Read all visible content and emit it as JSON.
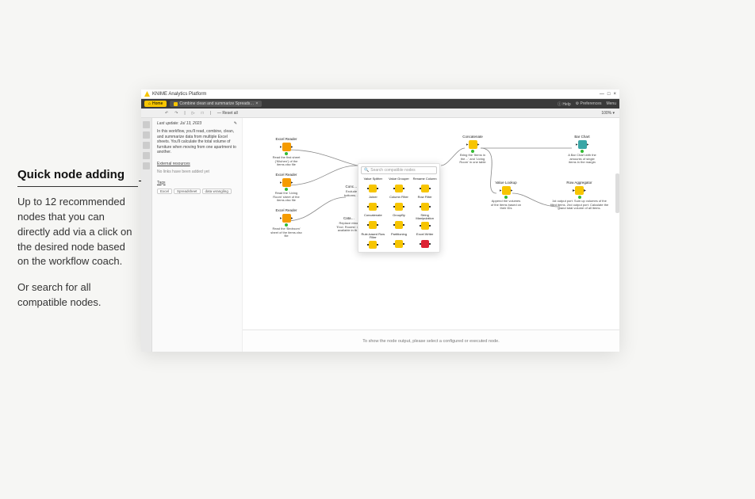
{
  "annotation": {
    "title": "Quick node adding",
    "p1": "Up to 12 recommended nodes that you can directly add via a click on the desired node based on the workflow coach.",
    "p2": "Or search for all compatible nodes."
  },
  "window": {
    "title": "KNIME Analytics Platform",
    "wmin": "—",
    "wmax": "□",
    "wclose": "×"
  },
  "topbar": {
    "home": "Home",
    "tab": "Combine clean and summarize Spreads…",
    "tab_close": "×",
    "help": "Help",
    "prefs": "Preferences",
    "menu": "Menu"
  },
  "toolbar": {
    "reset": "Reset all",
    "zoom": "100% ▾"
  },
  "side": {
    "date": "Last update: Jul 13, 2023",
    "desc": "In this workflow, you'll read, combine, clean, and summarize data from multiple Excel sheets. You'll calculate the total volume of furniture when moving from one apartment to another.",
    "ext": "External resources",
    "ext_note": "No links have been added yet",
    "tags_label": "Tags",
    "tags": [
      "Excel",
      "Spreadsheet",
      "data wrangling"
    ]
  },
  "wf": {
    "n1": {
      "label": "Excel Reader",
      "desc": "Read the first sheet ('Kitchen') of the items.xlsx file"
    },
    "n2": {
      "label": "Excel Reader",
      "desc": "Read the 'Living Room' sheet of the items.xlsx file"
    },
    "n3": {
      "label": "Excel Reader",
      "desc": "Read the 'Bedroom' sheet of the items.xlsx file"
    },
    "n4": {
      "label": "Conc…",
      "desc": "Exclude bottoms…"
    },
    "n5": {
      "label": "Cata…",
      "desc": "Replace miss. 'Excl. Rooms': us. available in th…"
    },
    "n6": {
      "label": "Concatenate",
      "desc": "Bring the 'Items in the…' and 'Living Room' in one table"
    },
    "n7": {
      "label": "Value Lookup",
      "desc": "Append the volumes of the items based on their IDs"
    },
    "n8": {
      "label": "Bar Chart",
      "desc": "A Bar Chart with the amounts of single items in the margin"
    },
    "n9": {
      "label": "Row Aggregator",
      "desc": "1st output port: Sum up volumes of the filled items. 2nd output port: Calculate the grand total volume of all items."
    }
  },
  "popup": {
    "search_ph": "Search compatible nodes",
    "items": [
      {
        "label": "Value Splitter",
        "cls": "yellow",
        "desc": ""
      },
      {
        "label": "Value Grouper",
        "cls": "yellow",
        "desc": ""
      },
      {
        "label": "Rename Column",
        "cls": "yellow",
        "desc": ""
      },
      {
        "label": "Joiner",
        "cls": "yellow",
        "desc": ""
      },
      {
        "label": "Column Filter",
        "cls": "yellow",
        "desc": ""
      },
      {
        "label": "Row Filter",
        "cls": "yellow",
        "desc": ""
      },
      {
        "label": "Concatenate",
        "cls": "yellow",
        "desc": ""
      },
      {
        "label": "GroupBy",
        "cls": "yellow",
        "desc": ""
      },
      {
        "label": "String Manipulation",
        "cls": "yellow",
        "desc": ""
      },
      {
        "label": "Rule-based Row Filter",
        "cls": "yellow",
        "desc": ""
      },
      {
        "label": "Partitioning",
        "cls": "yellow",
        "desc": ""
      },
      {
        "label": "Excel Writer",
        "cls": "red",
        "desc": ""
      }
    ]
  },
  "status": {
    "msg": "To show the node output, please select a configured or executed node."
  }
}
